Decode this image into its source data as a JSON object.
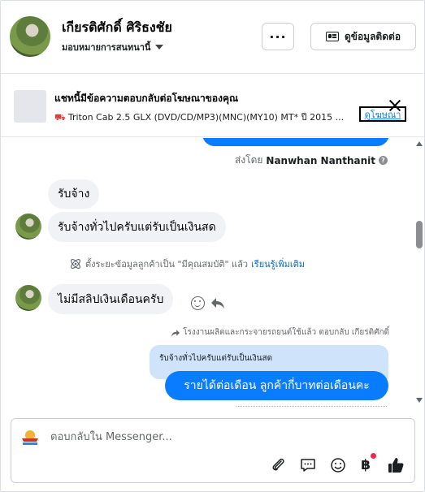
{
  "header": {
    "contact_name": "เกียรติศักดิ์ ศิริธงชัย",
    "assign_label": "มอบหมายการสนทนานี้",
    "more_label": "···",
    "contact_info_label": "ดูข้อมูลติดต่อ"
  },
  "ad_bar": {
    "title": "แชทนี้มีข้อความตอบกลับต่อโฆษณาของคุณ",
    "subtitle": "Triton Cab 2.5 GLX (DVD/CD/MP3)(MNC)(MY10) MT* ปี 2015 ...",
    "view_ad_label": "ดูโฆษณา"
  },
  "chat": {
    "sent_by_prefix": "ส่งโดย",
    "sent_by_name": "Nanwhan Nanthanit",
    "info_glyph": "?",
    "messages": [
      {
        "text": "รับจ้าง"
      },
      {
        "text": "รับจ้างทั่วไปครับแต่รับเป็นเงินสด"
      },
      {
        "text": "ไม่มีสลิปเงินเดือนครับ"
      }
    ],
    "system_note": {
      "text": "ตั้งระยะข้อมูลลูกค้าเป็น \"มีคุณสมบัติ\" แล้ว",
      "link": "เรียนรู้เพิ่มเติม"
    },
    "reply_note": "โรงงานผลิตและกระจายรถยนต์ใช้แล้ว ตอบกลับ เกียรติศักดิ์",
    "quoted_text": "รับจ้างทั่วไปครับแต่รับเป็นเงินสด",
    "outgoing_text": "รายได้ต่อเดือน  ลูกค้ากี่บาทต่อเดือนคะ"
  },
  "composer": {
    "placeholder": "ตอบกลับใน Messenger...",
    "pay_glyph": "฿"
  },
  "colors": {
    "accent_blue": "#0a7cff",
    "incoming_bubble": "#f0f2f5",
    "quoted_bubble": "#cfe3fb",
    "notification_dot": "#f02849"
  },
  "icons": [
    "idcard-icon",
    "caret-down-icon",
    "close-icon",
    "info-icon",
    "atom-icon",
    "smiley-icon",
    "reply-arrow-icon",
    "attach-icon",
    "saved-reply-icon",
    "emoji-icon",
    "baht-icon",
    "thumbs-up-icon"
  ]
}
